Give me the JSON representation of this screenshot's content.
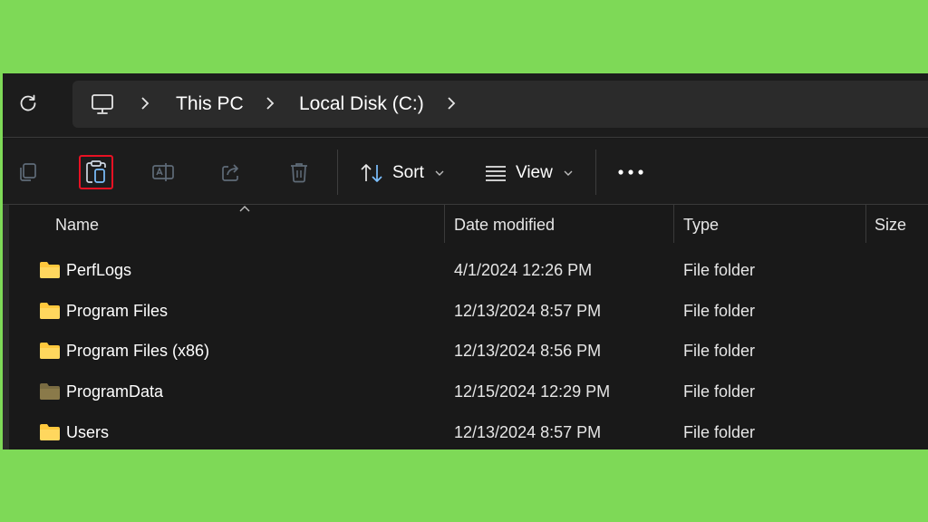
{
  "address": {
    "breadcrumbs": [
      "This PC",
      "Local Disk (C:)"
    ]
  },
  "toolbar": {
    "sort_label": "Sort",
    "view_label": "View"
  },
  "columns": {
    "name": "Name",
    "date": "Date modified",
    "type": "Type",
    "size": "Size"
  },
  "rows": [
    {
      "name": "PerfLogs",
      "date": "4/1/2024 12:26 PM",
      "type": "File folder",
      "icon": "folder-icon"
    },
    {
      "name": "Program Files",
      "date": "12/13/2024 8:57 PM",
      "type": "File folder",
      "icon": "folder-icon"
    },
    {
      "name": "Program Files (x86)",
      "date": "12/13/2024 8:56 PM",
      "type": "File folder",
      "icon": "folder-icon"
    },
    {
      "name": "ProgramData",
      "date": "12/15/2024 12:29 PM",
      "type": "File folder",
      "icon": "hidden-folder-icon"
    },
    {
      "name": "Users",
      "date": "12/13/2024 8:57 PM",
      "type": "File folder",
      "icon": "folder-icon"
    }
  ],
  "colors": {
    "background": "#7ed957",
    "window": "#191919",
    "folder": "#ffc83d",
    "hidden_folder": "#8a7a4a",
    "highlight": "#e81123"
  }
}
